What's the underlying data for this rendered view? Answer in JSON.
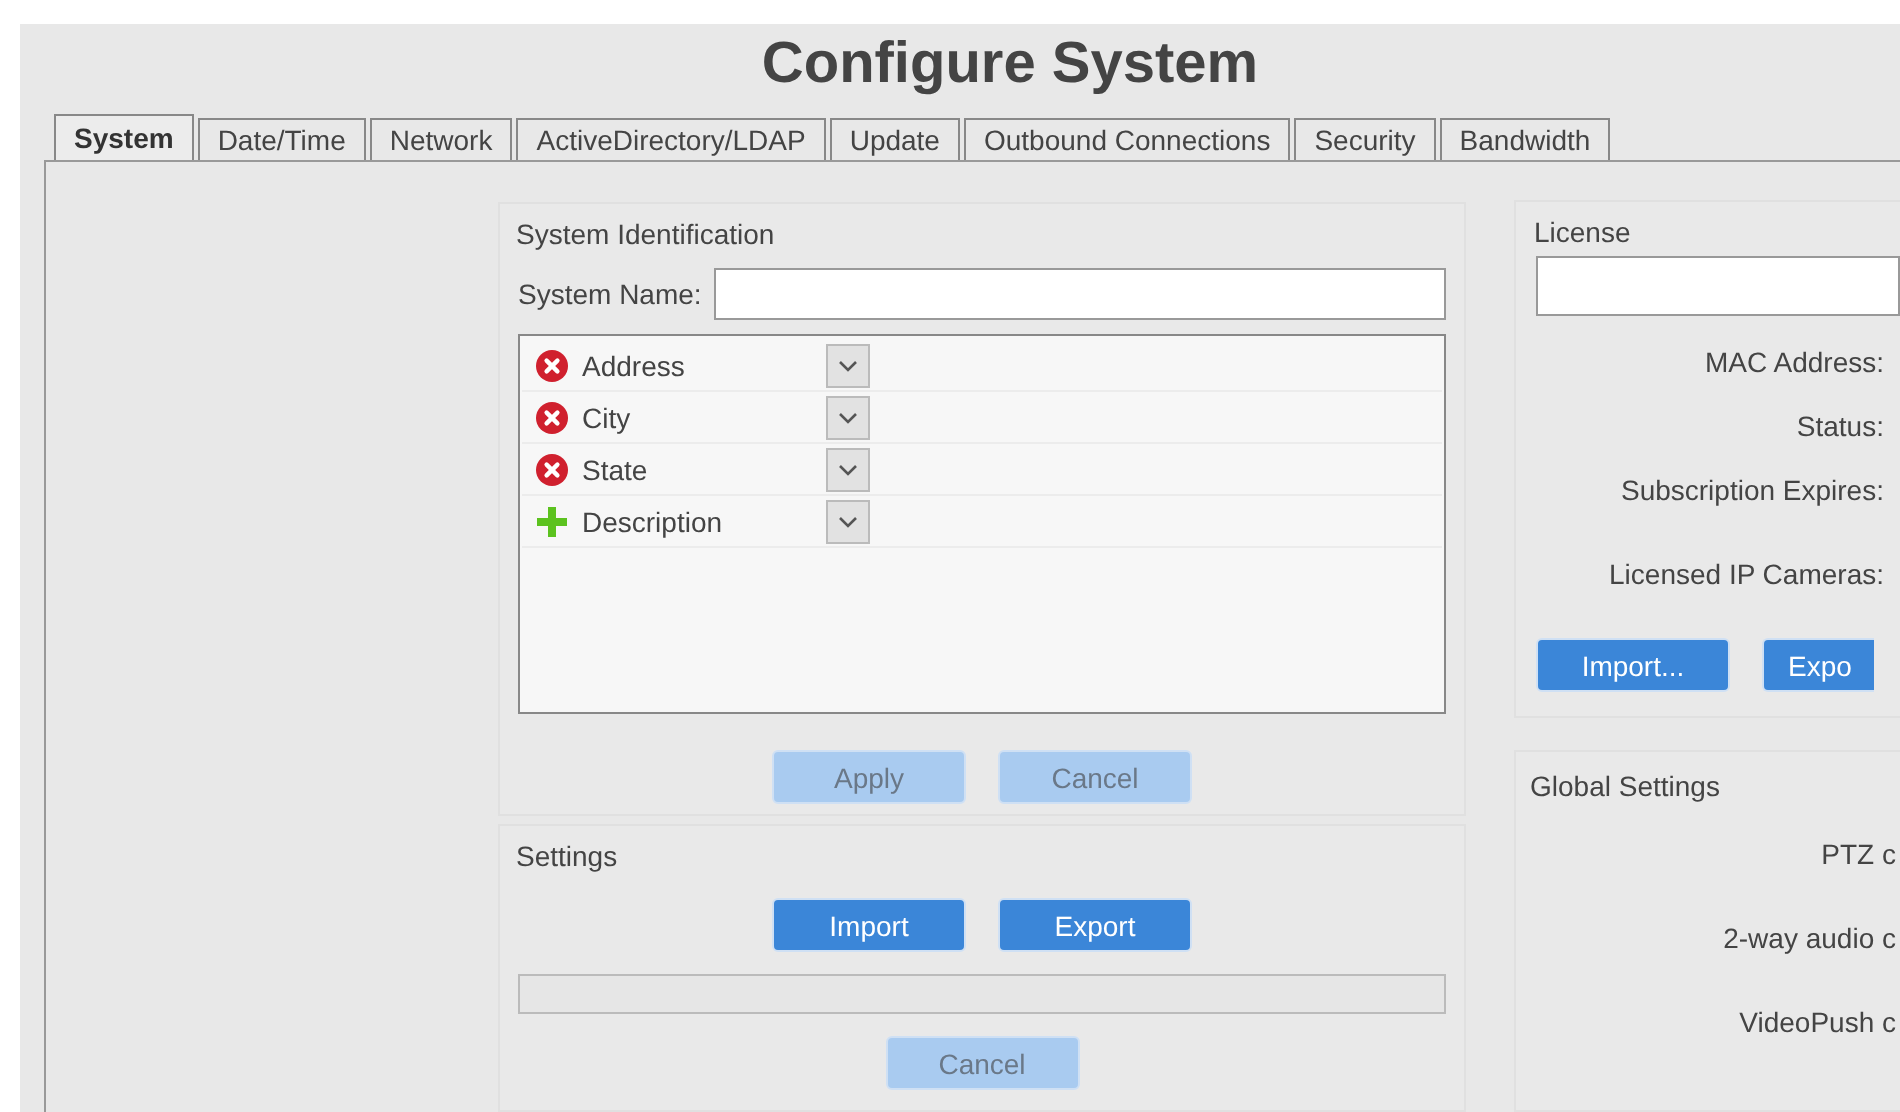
{
  "window": {
    "title": "Configure System"
  },
  "tabs": [
    {
      "label": "System",
      "selected": true
    },
    {
      "label": "Date/Time",
      "selected": false
    },
    {
      "label": "Network",
      "selected": false
    },
    {
      "label": "ActiveDirectory/LDAP",
      "selected": false
    },
    {
      "label": "Update",
      "selected": false
    },
    {
      "label": "Outbound Connections",
      "selected": false
    },
    {
      "label": "Security",
      "selected": false
    },
    {
      "label": "Bandwidth",
      "selected": false
    }
  ],
  "system_identification": {
    "title": "System Identification",
    "name_label": "System Name:",
    "fields": [
      {
        "kind": "remove",
        "label": "Address"
      },
      {
        "kind": "remove",
        "label": "City"
      },
      {
        "kind": "remove",
        "label": "State"
      },
      {
        "kind": "add",
        "label": "Description"
      }
    ],
    "buttons": [
      {
        "label": "Apply",
        "disabled": true
      },
      {
        "label": "Cancel",
        "disabled": true
      }
    ]
  },
  "settings": {
    "title": "Settings",
    "buttons": [
      {
        "label": "Import",
        "disabled": false
      },
      {
        "label": "Export",
        "disabled": false
      }
    ],
    "progress": {
      "level": 0
    },
    "cancel": {
      "label": "Cancel",
      "disabled": true
    }
  },
  "license": {
    "title": "License",
    "labels": [
      "MAC Address:",
      "Status:",
      "Subscription Expires:",
      "Licensed IP Cameras:"
    ],
    "buttons": [
      {
        "label": "Import...",
        "disabled": false
      },
      {
        "label": "Expo",
        "disabled": false
      }
    ]
  },
  "global_settings": {
    "title": "Global Settings",
    "labels": [
      "PTZ c",
      "2-way audio c",
      "VideoPush c"
    ]
  }
}
